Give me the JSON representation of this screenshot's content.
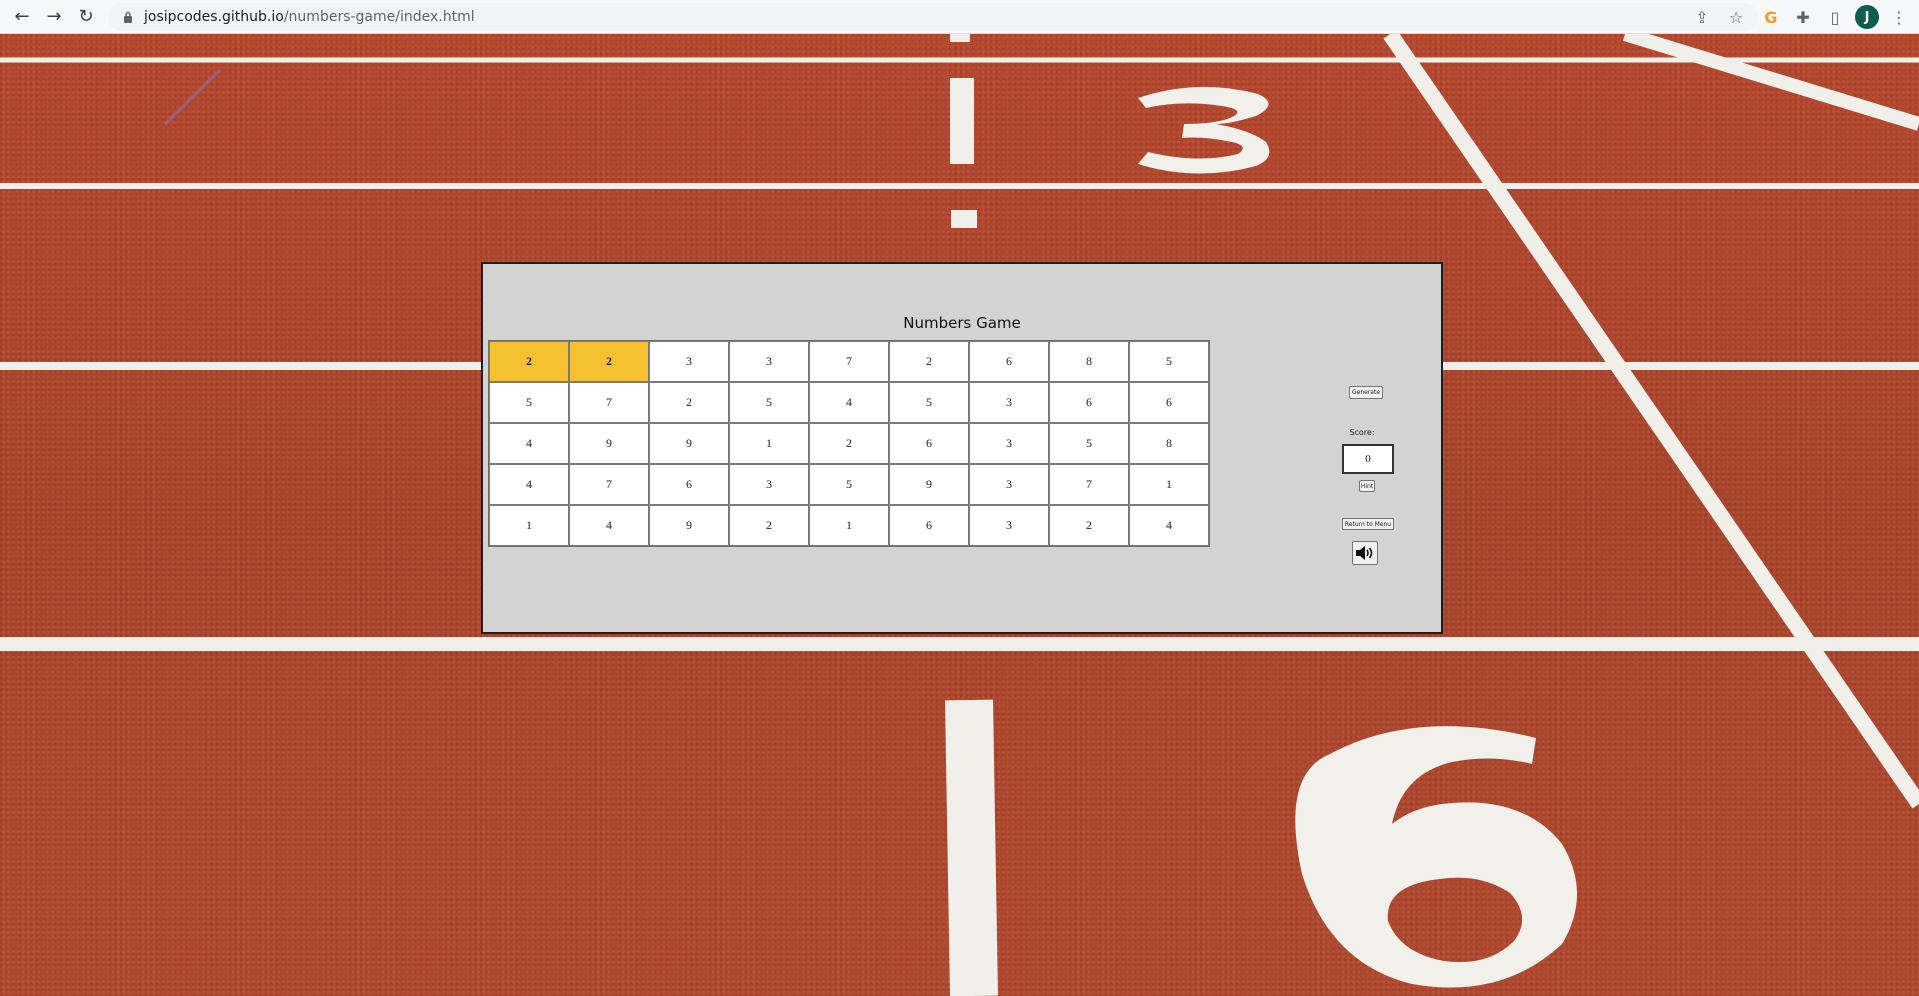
{
  "browser": {
    "url_host": "josipcodes.github.io",
    "url_path": "/numbers-game/index.html",
    "profile_initial": "J"
  },
  "game": {
    "title": "Numbers Game",
    "grid": [
      [
        "2",
        "2",
        "3",
        "3",
        "7",
        "2",
        "6",
        "8",
        "5"
      ],
      [
        "5",
        "7",
        "2",
        "5",
        "4",
        "5",
        "3",
        "6",
        "6"
      ],
      [
        "4",
        "9",
        "9",
        "1",
        "2",
        "6",
        "3",
        "5",
        "8"
      ],
      [
        "4",
        "7",
        "6",
        "3",
        "5",
        "9",
        "3",
        "7",
        "1"
      ],
      [
        "1",
        "4",
        "9",
        "2",
        "1",
        "6",
        "3",
        "2",
        "4"
      ]
    ],
    "selected_cells": [
      [
        0,
        0
      ],
      [
        0,
        1
      ]
    ],
    "generate_label": "Generate",
    "score_label": "Score:",
    "score_value": "0",
    "hint_label": "Hint",
    "return_label": "Return to Menu",
    "sound_icon": "speaker-icon"
  },
  "colors": {
    "selected_cell": "#f5c131",
    "panel_bg": "#d3d3d3",
    "track": "#b34a31"
  }
}
